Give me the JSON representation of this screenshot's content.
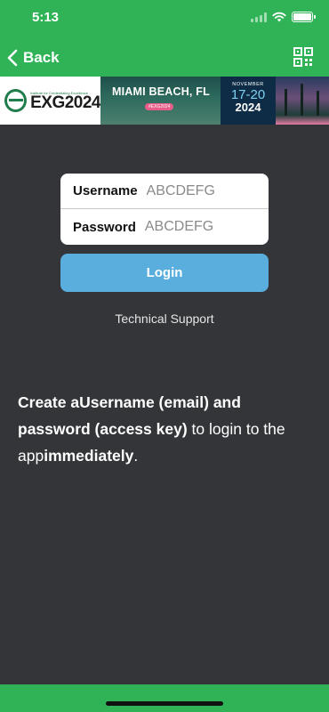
{
  "status_bar": {
    "time": "5:13"
  },
  "nav": {
    "back_label": "Back",
    "back_icon": "chevron-left-icon",
    "qr_icon": "qr-code-icon"
  },
  "banner": {
    "logo_tagline": "Institute for Credentialing Excellence",
    "logo_name": "EXG2024",
    "city": "MIAMI BEACH, FL",
    "hashtag": "#EXG2024",
    "month": "NOVEMBER",
    "dates": "17-20",
    "year": "2024"
  },
  "form": {
    "username_label": "Username",
    "username_placeholder": "ABCDEFG",
    "password_label": "Password",
    "password_placeholder": "ABCDEFG",
    "login_label": "Login"
  },
  "support_label": "Technical Support",
  "info": {
    "part1_bold": "Create aUsername (email) and password (access key)",
    "part2": " to login to the app",
    "part3_bold": "immediately",
    "part4": "."
  },
  "colors": {
    "accent": "#2fb356",
    "background": "#333538",
    "button": "#5aaedd"
  }
}
